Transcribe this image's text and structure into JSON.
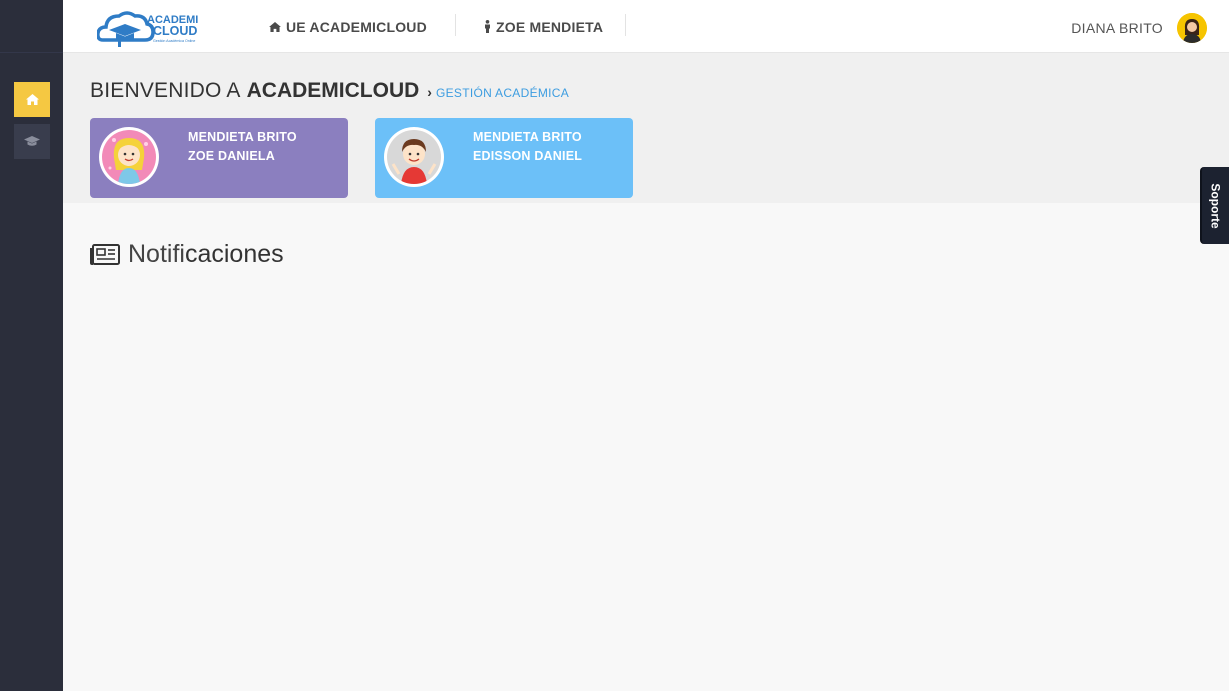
{
  "topbar": {
    "logo_top": "ACADEMI",
    "logo_bottom": "CLOUD",
    "logo_tagline": "Gestión Académica Online",
    "school_label": "UE ACADEMICLOUD",
    "student_label": "ZOE MENDIETA",
    "user_name": "DIANA BRITO"
  },
  "header": {
    "welcome_prefix": "BIENVENIDO A",
    "welcome_brand": "ACADEMICLOUD",
    "crumb_sep": "›",
    "crumb": "GESTIÓN ACADÉMICA"
  },
  "students": [
    {
      "surname": "MENDIETA BRITO",
      "given": "ZOE DANIELA",
      "color": "#8b7fbf"
    },
    {
      "surname": "MENDIETA BRITO",
      "given": "EDISSON DANIEL",
      "color": "#6cc0f8"
    }
  ],
  "notifications": {
    "title_light": "Notifi",
    "title_rest": "caciones"
  },
  "support": {
    "label": "Soporte"
  },
  "colors": {
    "sidebar": "#2b2e3b",
    "home_accent": "#f5c842",
    "crumb": "#3d9de0"
  }
}
